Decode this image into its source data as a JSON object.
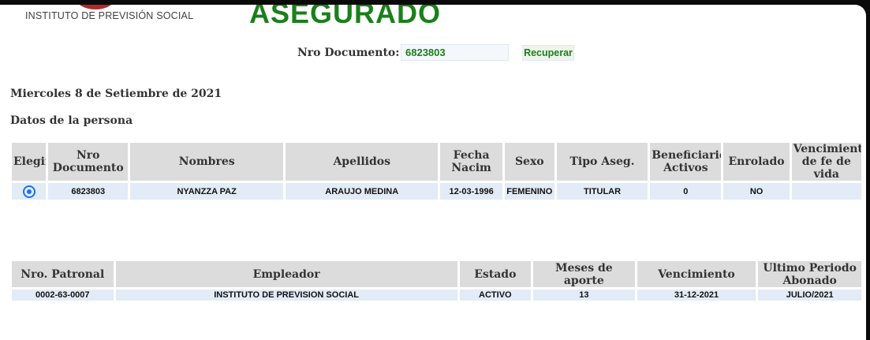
{
  "header": {
    "org_name": "INSTITUTO DE PREVISIÓN SOCIAL",
    "page_title": "ASEGURADO",
    "brand_color": "#1b7f1b"
  },
  "search": {
    "label": "Nro Documento:",
    "value": "6823803",
    "button_label": "Recuperar"
  },
  "date_text": "Miercoles 8 de Setiembre de 2021",
  "persona_section_title": "Datos de la persona",
  "persona_table": {
    "headers": [
      "Elegir",
      "Nro Documento",
      "Nombres",
      "Apellidos",
      "Fecha Nacim",
      "Sexo",
      "Tipo Aseg.",
      "Beneficiarios Activos",
      "Enrolado",
      "Vencimiento de fe de vida"
    ],
    "rows": [
      {
        "selected": true,
        "nro_documento": "6823803",
        "nombres": "NYANZZA PAZ",
        "apellidos": "ARAUJO MEDINA",
        "fecha_nacim": "12-03-1996",
        "sexo": "FEMENINO",
        "tipo_aseg": "TITULAR",
        "beneficiarios_activos": "0",
        "enrolado": "NO",
        "vencimiento_fe_vida": ""
      }
    ]
  },
  "empleo_table": {
    "headers": [
      "Nro. Patronal",
      "Empleador",
      "Estado",
      "Meses de aporte",
      "Vencimiento",
      "Ultimo Periodo Abonado"
    ],
    "rows": [
      {
        "nro_patronal": "0002-63-0007",
        "empleador": "INSTITUTO DE PREVISION SOCIAL",
        "estado": "ACTIVO",
        "meses_aporte": "13",
        "vencimiento": "31-12-2021",
        "ultimo_periodo": "JULIO/2021"
      }
    ]
  }
}
